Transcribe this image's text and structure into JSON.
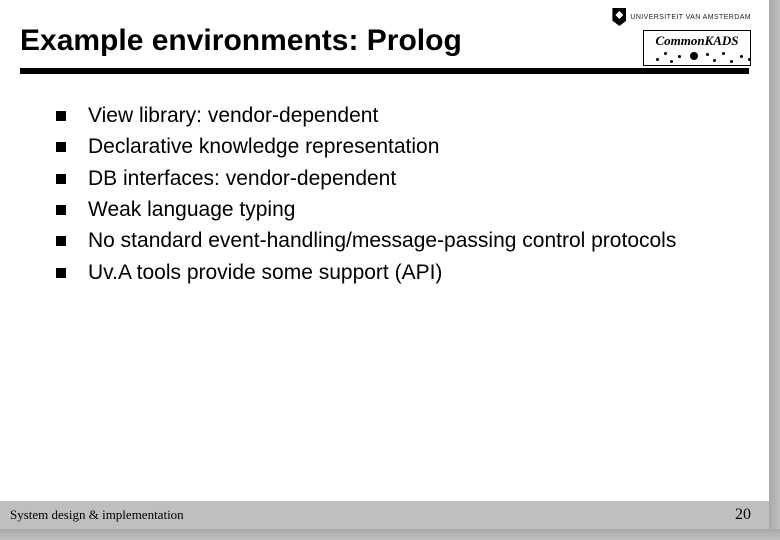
{
  "header": {
    "title": "Example environments: Prolog",
    "university_label": "UNIVERSITEIT VAN AMSTERDAM",
    "project_label": "CommonKADS"
  },
  "bullets": [
    "View library: vendor-dependent",
    "Declarative knowledge representation",
    "DB interfaces: vendor-dependent",
    "Weak language typing",
    "No standard event-handling/message-passing control protocols",
    "Uv.A tools provide some support (API)"
  ],
  "footer": {
    "left": "System design & implementation",
    "page": "20"
  }
}
